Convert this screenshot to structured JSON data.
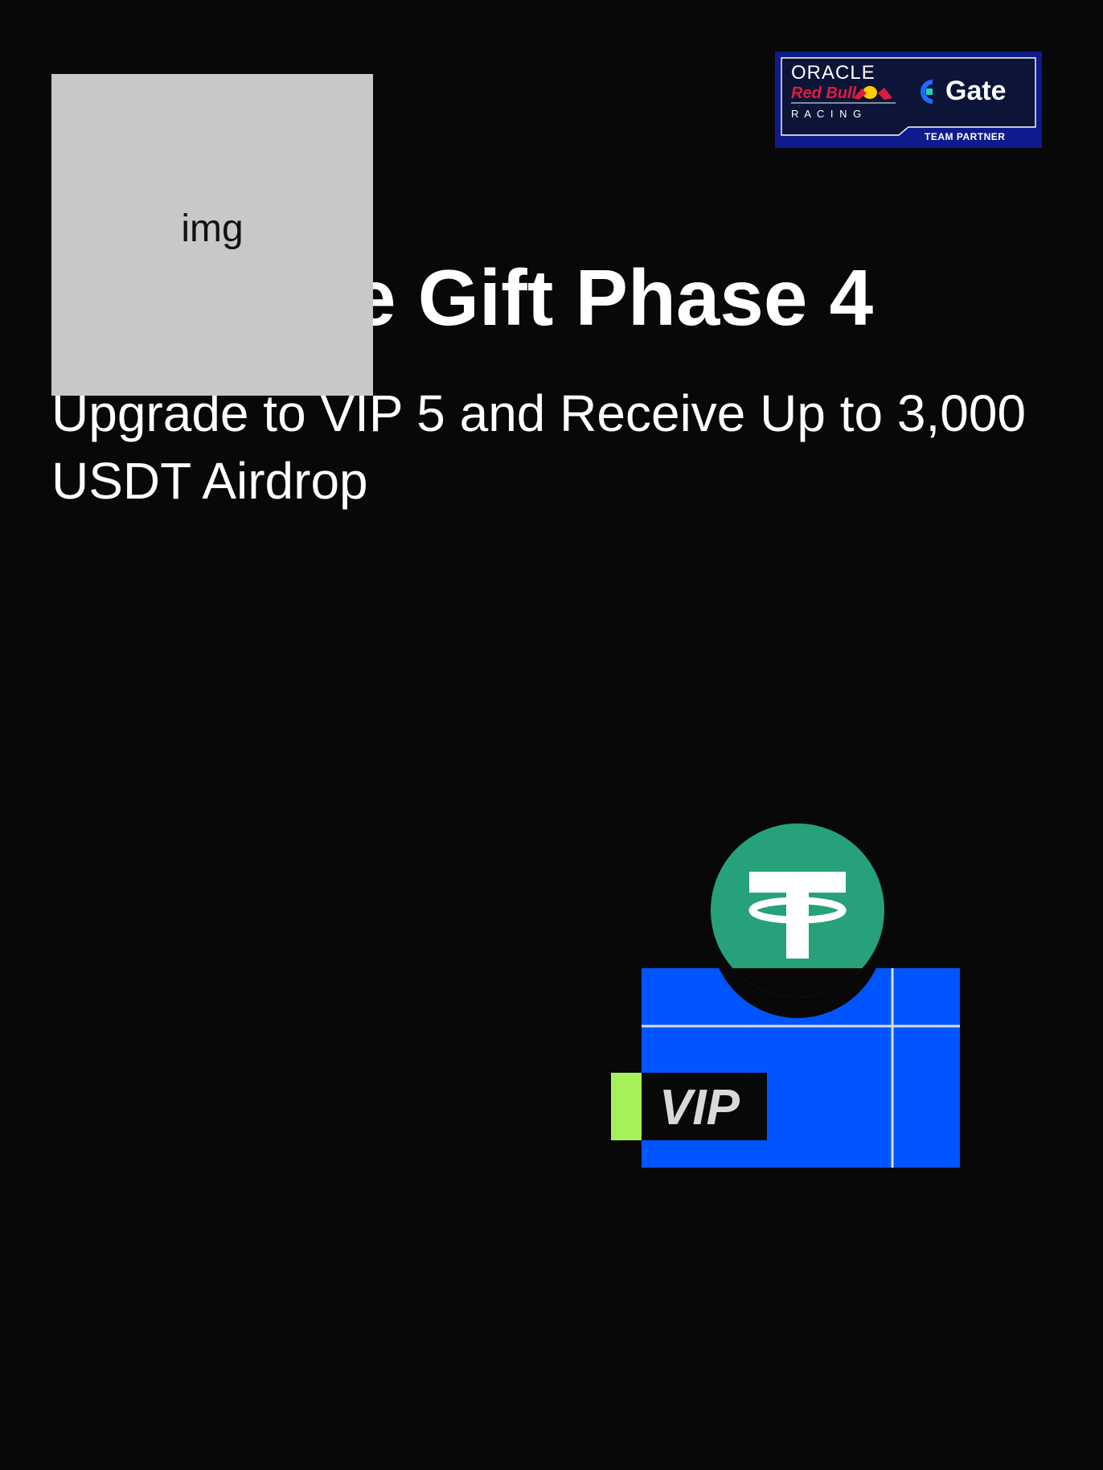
{
  "badge": {
    "line1": "ORACLE",
    "line2": "Red Bull",
    "line3": "R A C I N G",
    "brand": "Gate",
    "partner": "TEAM PARTNER",
    "icon": "gate-logo-icon"
  },
  "hero": {
    "title": "Welcome Gift Phase 4",
    "subtitle": "Upgrade to VIP 5 and Receive Up to 3,000 USDT Airdrop"
  },
  "placeholder": {
    "label": "img"
  },
  "illustration": {
    "vip_label": "VIP",
    "coin_icon": "tether-usdt-icon"
  },
  "colors": {
    "background": "#080808",
    "badge_bg": "#0f1a8c",
    "card_blue": "#0055ff",
    "tether_green": "#26a17b",
    "accent_lime": "#a6f05a",
    "placeholder_gray": "#c8c8c8"
  }
}
